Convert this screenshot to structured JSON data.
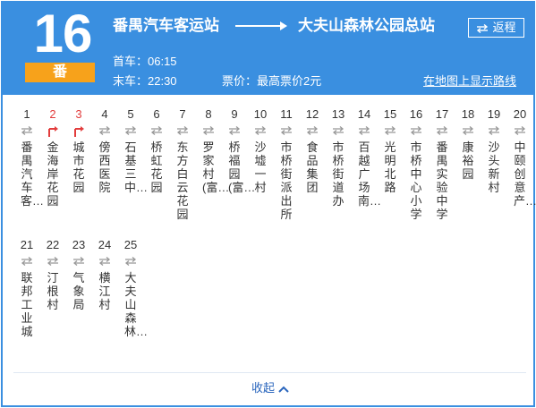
{
  "header": {
    "route_number": "16",
    "route_badge": "番",
    "from_station": "番禺汽车客运站",
    "to_station": "大夫山森林公园总站",
    "return_button": "返程",
    "first_bus": "首车：06:15",
    "last_bus": "末车：22:30",
    "fare": "票价：最高票价2元",
    "map_link": "在地图上显示路线"
  },
  "stops": [
    {
      "num": "1",
      "name": "番禺汽车客…",
      "highlight": false
    },
    {
      "num": "2",
      "name": "金海岸花园",
      "highlight": true
    },
    {
      "num": "3",
      "name": "城市花园",
      "highlight": true
    },
    {
      "num": "4",
      "name": "傍西医院",
      "highlight": false
    },
    {
      "num": "5",
      "name": "石基三中…",
      "highlight": false
    },
    {
      "num": "6",
      "name": "桥虹花园",
      "highlight": false
    },
    {
      "num": "7",
      "name": "东方白云花园",
      "highlight": false
    },
    {
      "num": "8",
      "name": "罗家村(富…",
      "highlight": false
    },
    {
      "num": "9",
      "name": "桥福园(富…",
      "highlight": false
    },
    {
      "num": "10",
      "name": "沙墟一村",
      "highlight": false
    },
    {
      "num": "11",
      "name": "市桥街派出所",
      "highlight": false
    },
    {
      "num": "12",
      "name": "食品集团",
      "highlight": false
    },
    {
      "num": "13",
      "name": "市桥街道办",
      "highlight": false
    },
    {
      "num": "14",
      "name": "百越广场南…",
      "highlight": false
    },
    {
      "num": "15",
      "name": "光明北路",
      "highlight": false
    },
    {
      "num": "16",
      "name": "市桥中心小学",
      "highlight": false
    },
    {
      "num": "17",
      "name": "番禺实验中学",
      "highlight": false
    },
    {
      "num": "18",
      "name": "康裕园",
      "highlight": false
    },
    {
      "num": "19",
      "name": "沙头新村",
      "highlight": false
    },
    {
      "num": "20",
      "name": "中颐创意产…",
      "highlight": false
    },
    {
      "num": "21",
      "name": "联邦工业城",
      "highlight": false
    },
    {
      "num": "22",
      "name": "汀根村",
      "highlight": false
    },
    {
      "num": "23",
      "name": "气象局",
      "highlight": false
    },
    {
      "num": "24",
      "name": "横江村",
      "highlight": false
    },
    {
      "num": "25",
      "name": "大夫山森林…",
      "highlight": false
    }
  ],
  "footer": {
    "collapse_label": "收起"
  },
  "colors": {
    "header_bg": "#3a8fe0",
    "badge_bg": "#f7a21b",
    "highlight": "#e23c3c",
    "link": "#2b66bd"
  },
  "icons": {
    "swap": "swap-icon",
    "direction": "direction-arrow-icon",
    "collapse": "chevron-up-icon"
  }
}
